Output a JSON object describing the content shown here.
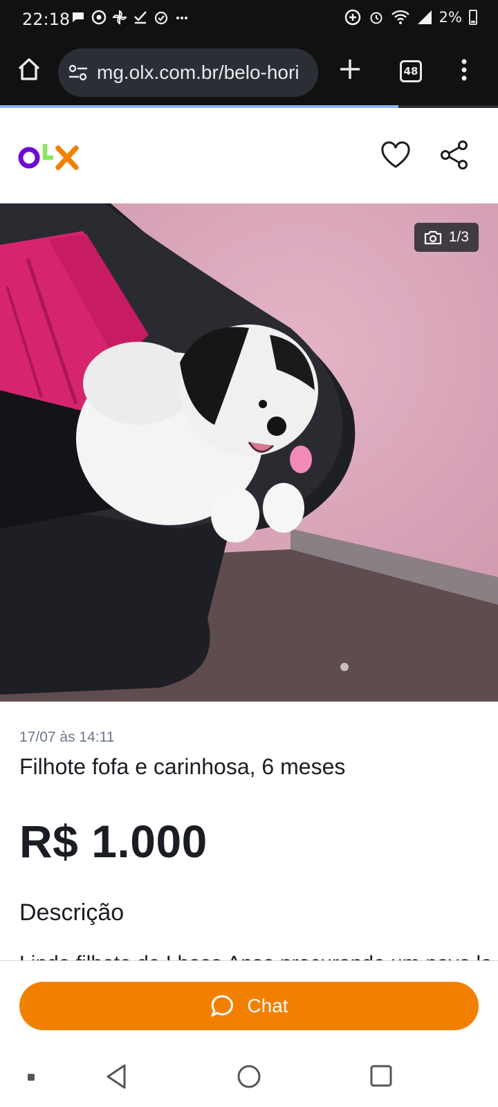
{
  "status_bar": {
    "time": "22:18",
    "left_icons": [
      "message-icon",
      "chrome-icon",
      "pinwheel-icon",
      "check-icon",
      "alarm-icon",
      "more-icon"
    ],
    "right_icons": [
      "data-saver-icon",
      "alarm-icon",
      "wifi-icon",
      "signal-icon"
    ],
    "battery": "2%"
  },
  "browser": {
    "url": "mg.olx.com.br/belo-hori",
    "tab_count": "48",
    "progress": 0.8
  },
  "brand": {
    "logo_text": "olx",
    "colors": {
      "o": "#6e0ad6",
      "l": "#8ce563",
      "x": "#f28000"
    }
  },
  "listing": {
    "photo_counter": "1/3",
    "date": "17/07 às 14:11",
    "title": "Filhote fofa e carinhosa, 6 meses",
    "price": "R$ 1.000",
    "description_heading": "Descrição",
    "description_preview": "Linda filhote de Lhasa Apso procurando um novo lar"
  },
  "chat": {
    "label": "Chat",
    "color": "#f28000"
  }
}
